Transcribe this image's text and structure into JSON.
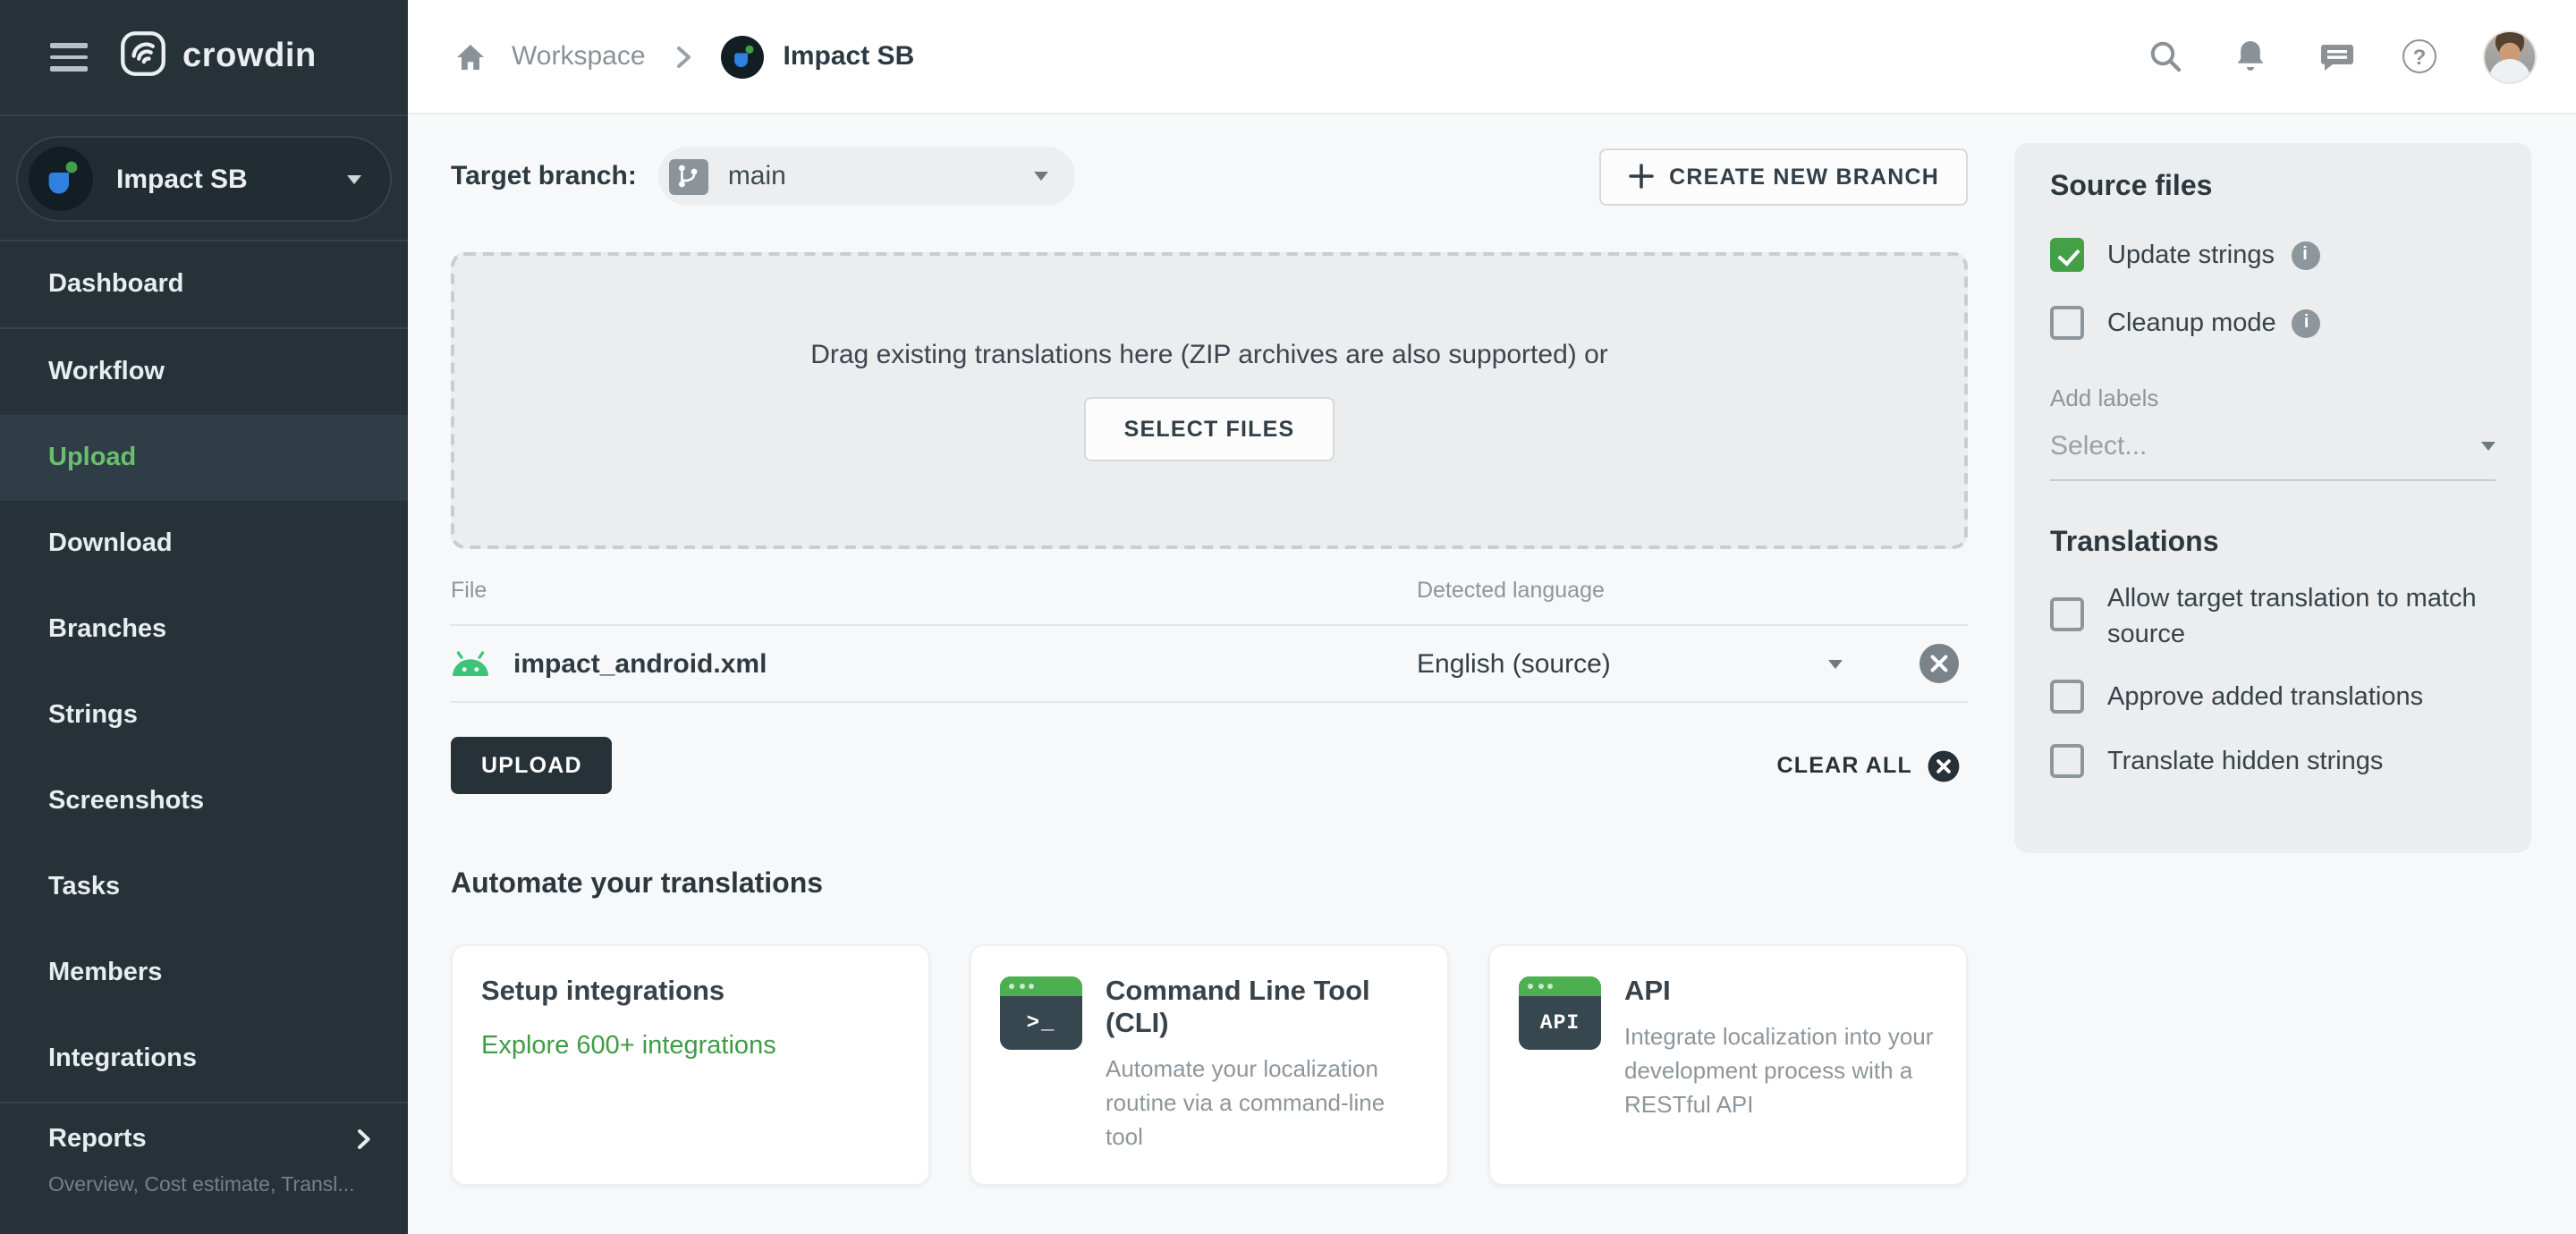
{
  "brand": {
    "name": "crowdin"
  },
  "topbar": {
    "breadcrumb": {
      "workspace": "Workspace",
      "project": "Impact SB"
    }
  },
  "sidebar": {
    "project_name": "Impact SB",
    "items": [
      {
        "label": "Dashboard",
        "active": false
      },
      {
        "label": "Workflow",
        "active": false
      },
      {
        "label": "Upload",
        "active": true
      },
      {
        "label": "Download",
        "active": false
      },
      {
        "label": "Branches",
        "active": false
      },
      {
        "label": "Strings",
        "active": false
      },
      {
        "label": "Screenshots",
        "active": false
      },
      {
        "label": "Tasks",
        "active": false
      },
      {
        "label": "Members",
        "active": false
      },
      {
        "label": "Integrations",
        "active": false
      }
    ],
    "reports": {
      "label": "Reports",
      "sub": "Overview, Cost estimate, Transl..."
    }
  },
  "main": {
    "target_branch_label": "Target branch:",
    "branch": {
      "name": "main"
    },
    "create_branch_label": "CREATE NEW BRANCH",
    "dropzone": {
      "text": "Drag existing translations here (ZIP archives are also supported) or",
      "select_files_label": "SELECT FILES"
    },
    "files_table": {
      "headers": {
        "file": "File",
        "language": "Detected language"
      },
      "rows": [
        {
          "name": "impact_android.xml",
          "language": "English (source)"
        }
      ]
    },
    "upload_label": "UPLOAD",
    "clear_all_label": "CLEAR ALL",
    "automate": {
      "heading": "Automate your translations",
      "cards": [
        {
          "title": "Setup integrations",
          "link": "Explore 600+ integrations"
        },
        {
          "title": "Command Line Tool (CLI)",
          "desc": "Automate your localization routine via a command-line tool",
          "icon_text": ">_"
        },
        {
          "title": "API",
          "desc": "Integrate localization into your development process with a RESTful API",
          "icon_text": "API"
        }
      ]
    }
  },
  "panel": {
    "source_files": {
      "heading": "Source files",
      "options": [
        {
          "label": "Update strings",
          "checked": true
        },
        {
          "label": "Cleanup mode",
          "checked": false
        }
      ],
      "add_labels_label": "Add labels",
      "labels_placeholder": "Select..."
    },
    "translations": {
      "heading": "Translations",
      "options": [
        {
          "label": "Allow target translation to match source",
          "checked": false
        },
        {
          "label": "Approve added translations",
          "checked": false
        },
        {
          "label": "Translate hidden strings",
          "checked": false
        }
      ]
    }
  },
  "colors": {
    "sidebar_bg": "#263238",
    "active_item_green": "#6abf6e",
    "accent_green": "#43a047",
    "panel_bg": "#ebedee",
    "dark_button": "#263238",
    "link_green": "#3f9d46"
  }
}
